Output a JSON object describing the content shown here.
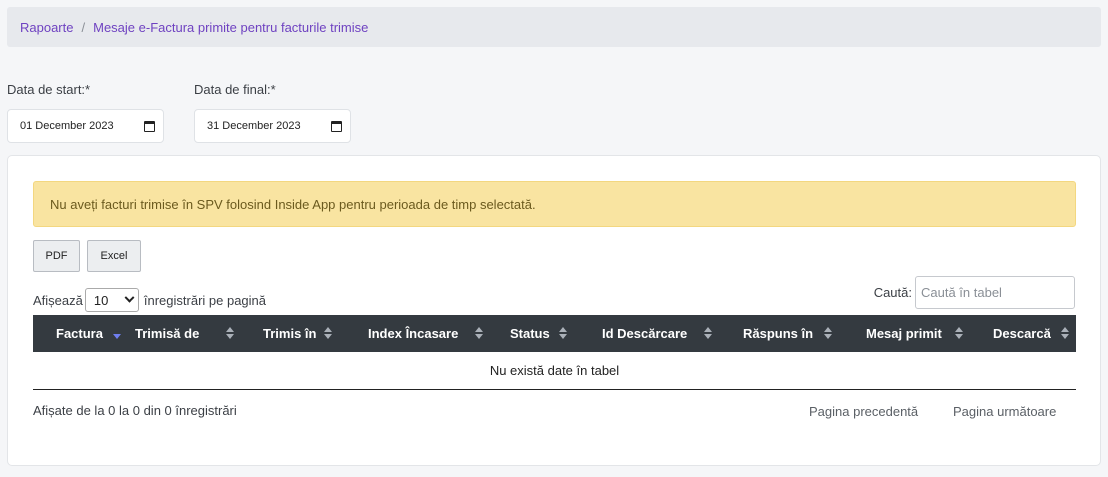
{
  "breadcrumb": {
    "root": "Rapoarte",
    "separator": "/",
    "current": "Mesaje e-Factura primite pentru facturile trimise"
  },
  "filters": {
    "start_label": "Data de start:*",
    "start_value": "01 December 2023",
    "end_label": "Data de final:*",
    "end_value": "31 December 2023"
  },
  "alert": {
    "text": "Nu aveți facturi trimise în SPV folosind Inside App pentru perioada de timp selectată."
  },
  "export": {
    "pdf_label": "PDF",
    "excel_label": "Excel"
  },
  "length": {
    "prefix": "Afișează",
    "value": "10",
    "suffix": "înregistrări pe pagină"
  },
  "search": {
    "label": "Caută:",
    "placeholder": "Caută în tabel"
  },
  "table": {
    "columns": [
      "Factura",
      "Trimisă de",
      "Trimis în",
      "Index Încasare",
      "Status",
      "Id Descărcare",
      "Răspuns în",
      "Mesaj primit",
      "Descarcă"
    ],
    "empty_text": "Nu există date în tabel"
  },
  "footer": {
    "info": "Afișate de la 0 la 0 din 0 înregistrări",
    "prev": "Pagina precedentă",
    "next": "Pagina următoare"
  }
}
